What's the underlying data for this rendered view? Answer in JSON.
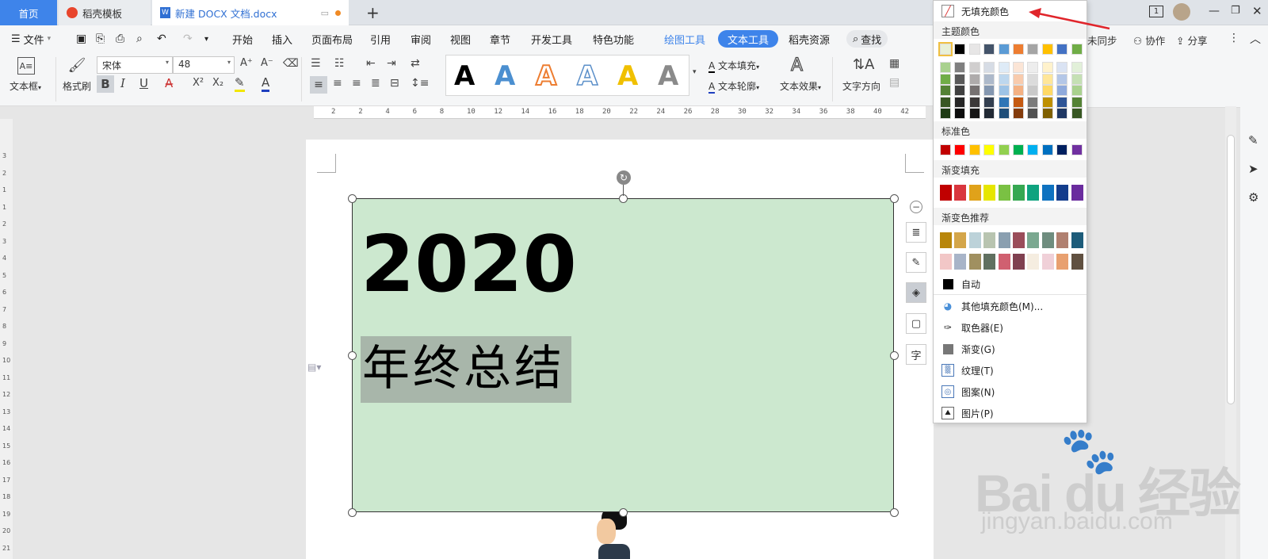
{
  "tabs": {
    "home": "首页",
    "template": "稻壳模板",
    "document": "新建 DOCX 文档.docx",
    "add": "+"
  },
  "window": {
    "page_indicator": "1"
  },
  "menu": {
    "file": "文件",
    "items": [
      "开始",
      "插入",
      "页面布局",
      "引用",
      "审阅",
      "视图",
      "章节",
      "开发工具",
      "特色功能",
      "绘图工具",
      "文本工具",
      "稻壳资源"
    ],
    "search": "查找",
    "sync": "未同步",
    "collab": "协作",
    "share": "分享"
  },
  "ribbon": {
    "textbox": "文本框",
    "format_painter": "格式刷",
    "font_name": "宋体",
    "font_size": "48",
    "bold": "B",
    "italic": "I",
    "underline": "U",
    "text_fill": "文本填充",
    "text_outline": "文本轮廓",
    "text_effect": "文本效果",
    "text_direction": "文字方向",
    "art_letter": "A",
    "increase_font": "A⁺",
    "decrease_font": "A⁻",
    "superscript": "X²",
    "subscript": "X₂"
  },
  "ruler": {
    "marks": [
      "2",
      "2",
      "4",
      "6",
      "8",
      "10",
      "12",
      "14",
      "16",
      "18",
      "20",
      "22",
      "24",
      "26",
      "28",
      "30",
      "32",
      "34",
      "36",
      "38",
      "40",
      "42"
    ]
  },
  "vruler": {
    "marks": [
      "3",
      "2",
      "1",
      "1",
      "2",
      "3",
      "4",
      "5",
      "6",
      "7",
      "8",
      "9",
      "10",
      "11",
      "12",
      "13",
      "14",
      "15",
      "16",
      "17",
      "18",
      "19",
      "20",
      "21"
    ]
  },
  "document": {
    "year": "2020",
    "subtitle": "年终总结"
  },
  "side_tools": [
    "字"
  ],
  "dropdown": {
    "no_fill": "无填充颜色",
    "theme_colors": "主题颜色",
    "standard_colors": "标准色",
    "gradient_fill": "渐变填充",
    "gradient_recommend": "渐变色推荐",
    "auto": "自动",
    "more_colors": "其他填充颜色(M)...",
    "eyedropper": "取色器(E)",
    "gradient": "渐变(G)",
    "texture": "纹理(T)",
    "pattern": "图案(N)",
    "picture": "图片(P)",
    "theme_row": [
      "#ffffff",
      "#000000",
      "#e7e6e6",
      "#44546a",
      "#5b9bd5",
      "#ed7d31",
      "#a5a5a5",
      "#ffc000",
      "#4472c4",
      "#70ad47"
    ],
    "theme_shades": [
      [
        "#a9d18e",
        "#7f7f7f",
        "#d0cece",
        "#d6dce5",
        "#deebf7",
        "#fbe5d6",
        "#ededed",
        "#fff2cc",
        "#dae3f3",
        "#e2f0d9"
      ],
      [
        "#70ad47",
        "#595959",
        "#aeabab",
        "#adb9ca",
        "#bdd7ee",
        "#f8cbad",
        "#dbdbdb",
        "#ffe699",
        "#b4c7e7",
        "#c5e0b4"
      ],
      [
        "#548235",
        "#404040",
        "#767171",
        "#8497b0",
        "#9dc3e6",
        "#f4b183",
        "#c9c9c9",
        "#ffd966",
        "#8faadc",
        "#a9d18e"
      ],
      [
        "#385723",
        "#262626",
        "#3b3838",
        "#333f50",
        "#2e75b6",
        "#c55a11",
        "#7b7b7b",
        "#bf9000",
        "#2f5597",
        "#548235"
      ],
      [
        "#1e3b14",
        "#0d0d0d",
        "#171616",
        "#222a35",
        "#1f4e79",
        "#843c0c",
        "#525252",
        "#7f6000",
        "#203864",
        "#385723"
      ]
    ],
    "standard_row": [
      "#c00000",
      "#ff0000",
      "#ffc000",
      "#ffff00",
      "#92d050",
      "#00b050",
      "#00b0f0",
      "#0070c0",
      "#002060",
      "#7030a0"
    ],
    "gradient_row": [
      "#c00000",
      "#d9363e",
      "#e0a21a",
      "#e6e600",
      "#7ac143",
      "#36a852",
      "#0fa37f",
      "#0f72c0",
      "#143d8c",
      "#6a2c9e"
    ],
    "recommend_row1": [
      "#b8860b",
      "#d4a64a",
      "#bcd2d9",
      "#b8c4b0",
      "#8a9fb0",
      "#9a4d5a",
      "#7aa890",
      "#6f8d7f",
      "#b08070",
      "#1d5c7a"
    ],
    "recommend_row2": [
      "#f2c7c7",
      "#a8b4c8",
      "#a09060",
      "#607060",
      "#d06070",
      "#804050",
      "#f5ede0",
      "#f0d0d8",
      "#e8a070",
      "#605040"
    ]
  },
  "colors": {
    "accent": "#3e84ea",
    "textbox_fill": "#cce8cf",
    "arrow": "#e0252b"
  }
}
